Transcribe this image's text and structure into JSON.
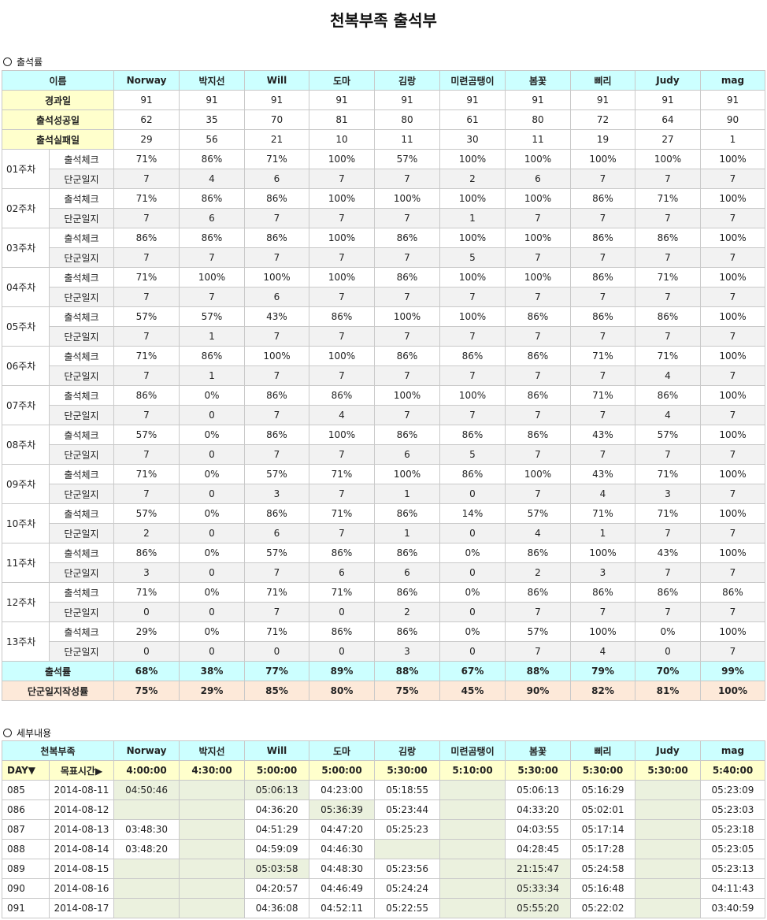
{
  "title": "천복부족 출석부",
  "section1": {
    "label": "출석률",
    "header_label": "이름",
    "members": [
      "Norway",
      "박지선",
      "Will",
      "도마",
      "김랑",
      "미련곰탱이",
      "봄꽃",
      "삐리",
      "Judy",
      "mag"
    ],
    "summary_rows": [
      {
        "label": "경과일",
        "values": [
          "91",
          "91",
          "91",
          "91",
          "91",
          "91",
          "91",
          "91",
          "91",
          "91"
        ]
      },
      {
        "label": "출석성공일",
        "values": [
          "62",
          "35",
          "70",
          "81",
          "80",
          "61",
          "80",
          "72",
          "64",
          "90"
        ]
      },
      {
        "label": "출석실패일",
        "values": [
          "29",
          "56",
          "21",
          "10",
          "11",
          "30",
          "11",
          "19",
          "27",
          "1"
        ]
      }
    ],
    "check_label": "출석체크",
    "diary_label": "단군일지",
    "weeks": [
      {
        "label": "01주차",
        "check": [
          "71%",
          "86%",
          "71%",
          "100%",
          "57%",
          "100%",
          "100%",
          "100%",
          "100%",
          "100%"
        ],
        "diary": [
          "7",
          "4",
          "6",
          "7",
          "7",
          "2",
          "6",
          "7",
          "7",
          "7"
        ]
      },
      {
        "label": "02주차",
        "check": [
          "71%",
          "86%",
          "86%",
          "100%",
          "100%",
          "100%",
          "100%",
          "86%",
          "71%",
          "100%"
        ],
        "diary": [
          "7",
          "6",
          "7",
          "7",
          "7",
          "1",
          "7",
          "7",
          "7",
          "7"
        ]
      },
      {
        "label": "03주차",
        "check": [
          "86%",
          "86%",
          "86%",
          "100%",
          "86%",
          "100%",
          "100%",
          "86%",
          "86%",
          "100%"
        ],
        "diary": [
          "7",
          "7",
          "7",
          "7",
          "7",
          "5",
          "7",
          "7",
          "7",
          "7"
        ]
      },
      {
        "label": "04주차",
        "check": [
          "71%",
          "100%",
          "100%",
          "100%",
          "86%",
          "100%",
          "100%",
          "86%",
          "71%",
          "100%"
        ],
        "diary": [
          "7",
          "7",
          "6",
          "7",
          "7",
          "7",
          "7",
          "7",
          "7",
          "7"
        ]
      },
      {
        "label": "05주차",
        "check": [
          "57%",
          "57%",
          "43%",
          "86%",
          "100%",
          "100%",
          "86%",
          "86%",
          "86%",
          "100%"
        ],
        "diary": [
          "7",
          "1",
          "7",
          "7",
          "7",
          "7",
          "7",
          "7",
          "7",
          "7"
        ]
      },
      {
        "label": "06주차",
        "check": [
          "71%",
          "86%",
          "100%",
          "100%",
          "86%",
          "86%",
          "86%",
          "71%",
          "71%",
          "100%"
        ],
        "diary": [
          "7",
          "1",
          "7",
          "7",
          "7",
          "7",
          "7",
          "7",
          "4",
          "7"
        ]
      },
      {
        "label": "07주차",
        "check": [
          "86%",
          "0%",
          "86%",
          "86%",
          "100%",
          "100%",
          "86%",
          "71%",
          "86%",
          "100%"
        ],
        "diary": [
          "7",
          "0",
          "7",
          "4",
          "7",
          "7",
          "7",
          "7",
          "4",
          "7"
        ]
      },
      {
        "label": "08주차",
        "check": [
          "57%",
          "0%",
          "86%",
          "100%",
          "86%",
          "86%",
          "86%",
          "43%",
          "57%",
          "100%"
        ],
        "diary": [
          "7",
          "0",
          "7",
          "7",
          "6",
          "5",
          "7",
          "7",
          "7",
          "7"
        ]
      },
      {
        "label": "09주차",
        "check": [
          "71%",
          "0%",
          "57%",
          "71%",
          "100%",
          "86%",
          "100%",
          "43%",
          "71%",
          "100%"
        ],
        "diary": [
          "7",
          "0",
          "3",
          "7",
          "1",
          "0",
          "7",
          "4",
          "3",
          "7"
        ]
      },
      {
        "label": "10주차",
        "check": [
          "57%",
          "0%",
          "86%",
          "71%",
          "86%",
          "14%",
          "57%",
          "71%",
          "71%",
          "100%"
        ],
        "diary": [
          "2",
          "0",
          "6",
          "7",
          "1",
          "0",
          "4",
          "1",
          "7",
          "7"
        ]
      },
      {
        "label": "11주차",
        "check": [
          "86%",
          "0%",
          "57%",
          "86%",
          "86%",
          "0%",
          "86%",
          "100%",
          "43%",
          "100%"
        ],
        "diary": [
          "3",
          "0",
          "7",
          "6",
          "6",
          "0",
          "2",
          "3",
          "7",
          "7"
        ]
      },
      {
        "label": "12주차",
        "check": [
          "71%",
          "0%",
          "71%",
          "71%",
          "86%",
          "0%",
          "86%",
          "86%",
          "86%",
          "86%"
        ],
        "diary": [
          "0",
          "0",
          "7",
          "0",
          "2",
          "0",
          "7",
          "7",
          "7",
          "7"
        ]
      },
      {
        "label": "13주차",
        "check": [
          "29%",
          "0%",
          "71%",
          "86%",
          "86%",
          "0%",
          "57%",
          "100%",
          "0%",
          "100%"
        ],
        "diary": [
          "0",
          "0",
          "0",
          "0",
          "3",
          "0",
          "7",
          "4",
          "0",
          "7"
        ]
      }
    ],
    "rate_rows": [
      {
        "label": "출석률",
        "values": [
          "68%",
          "38%",
          "77%",
          "89%",
          "88%",
          "67%",
          "88%",
          "79%",
          "70%",
          "99%"
        ]
      },
      {
        "label": "단군일지작성률",
        "values": [
          "75%",
          "29%",
          "85%",
          "80%",
          "75%",
          "45%",
          "90%",
          "82%",
          "81%",
          "100%"
        ]
      }
    ]
  },
  "section2": {
    "label": "세부내용",
    "header_label": "천복부족",
    "members": [
      "Norway",
      "박지선",
      "Will",
      "도마",
      "김랑",
      "미련곰탱이",
      "봄꽃",
      "삐리",
      "Judy",
      "mag"
    ],
    "day_label": "DAY▼",
    "target_label": "목표시간▶",
    "targets": [
      "4:00:00",
      "4:30:00",
      "5:00:00",
      "5:00:00",
      "5:30:00",
      "5:10:00",
      "5:30:00",
      "5:30:00",
      "5:30:00",
      "5:40:00"
    ],
    "rows": [
      {
        "day": "085",
        "date": "2014-08-11",
        "times": [
          "04:50:46",
          "",
          "05:06:13",
          "04:23:00",
          "05:18:55",
          "",
          "05:06:13",
          "05:16:29",
          "",
          "05:23:09"
        ]
      },
      {
        "day": "086",
        "date": "2014-08-12",
        "times": [
          "",
          "",
          "04:36:20",
          "05:36:39",
          "05:23:44",
          "",
          "04:33:20",
          "05:02:01",
          "",
          "05:23:03"
        ]
      },
      {
        "day": "087",
        "date": "2014-08-13",
        "times": [
          "03:48:30",
          "",
          "04:51:29",
          "04:47:20",
          "05:25:23",
          "",
          "04:03:55",
          "05:17:14",
          "",
          "05:23:18"
        ]
      },
      {
        "day": "088",
        "date": "2014-08-14",
        "times": [
          "03:48:20",
          "",
          "04:59:09",
          "04:46:30",
          "",
          "",
          "04:28:45",
          "05:17:28",
          "",
          "05:23:05"
        ]
      },
      {
        "day": "089",
        "date": "2014-08-15",
        "times": [
          "",
          "",
          "05:03:58",
          "04:48:30",
          "05:23:56",
          "",
          "21:15:47",
          "05:24:58",
          "",
          "05:23:13"
        ]
      },
      {
        "day": "090",
        "date": "2014-08-16",
        "times": [
          "",
          "",
          "04:20:57",
          "04:46:49",
          "05:24:24",
          "",
          "05:33:34",
          "05:16:48",
          "",
          "04:11:43"
        ]
      },
      {
        "day": "091",
        "date": "2014-08-17",
        "times": [
          "",
          "",
          "04:36:08",
          "04:52:11",
          "05:22:55",
          "",
          "05:55:20",
          "05:22:02",
          "",
          "03:40:59"
        ]
      }
    ]
  }
}
